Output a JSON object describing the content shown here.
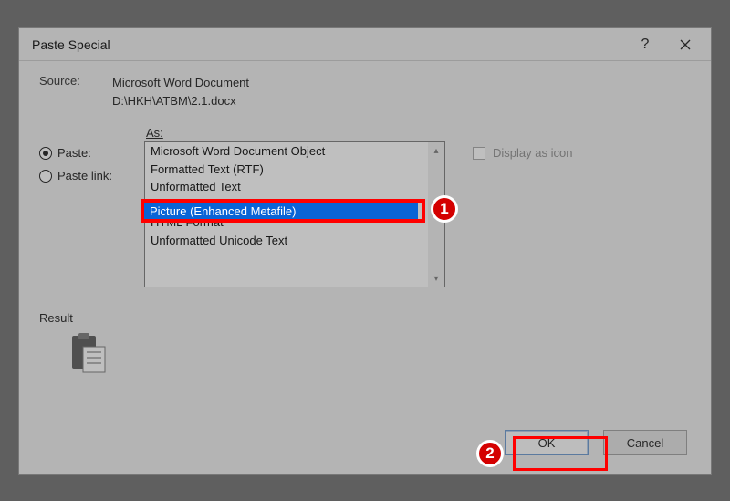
{
  "dialog": {
    "title": "Paste Special",
    "source_label": "Source:",
    "source_app": "Microsoft Word Document",
    "source_path": "D:\\HKH\\ATBM\\2.1.docx",
    "as_label": "As:",
    "radios": {
      "paste": "Paste:",
      "paste_link": "Paste link:"
    },
    "list": [
      "Microsoft Word Document Object",
      "Formatted Text (RTF)",
      "Unformatted Text",
      "Picture (Enhanced Metafile)",
      "HTML Format",
      "Unformatted Unicode Text"
    ],
    "selected_index": 3,
    "display_as_icon": "Display as icon",
    "result_label": "Result",
    "ok": "OK",
    "cancel": "Cancel"
  },
  "callouts": {
    "one": "1",
    "two": "2"
  }
}
